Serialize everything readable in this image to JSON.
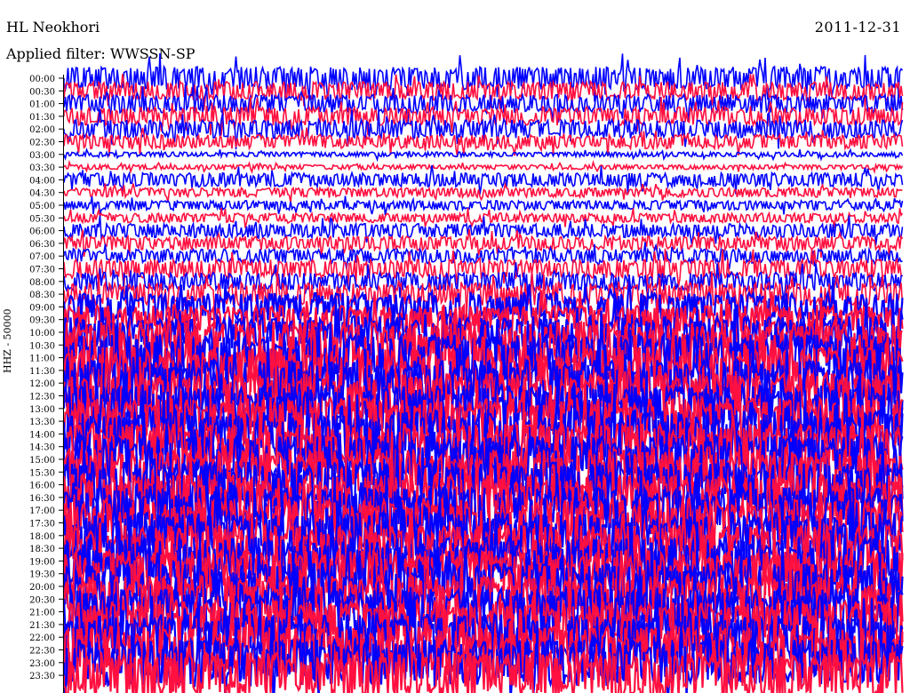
{
  "header": {
    "station": "HL Neokhori",
    "date": "2011-12-31",
    "filter_label": "Applied filter: WWSSN-SP"
  },
  "chart_data": {
    "type": "line",
    "title": "HL Neokhori",
    "subtitle": "Applied filter: WWSSN-SP",
    "ylabel": "HHZ - 50000",
    "row_labels": [
      "00:00",
      "00:30",
      "01:00",
      "01:30",
      "02:00",
      "02:30",
      "03:00",
      "03:30",
      "04:00",
      "04:30",
      "05:00",
      "05:30",
      "06:00",
      "06:30",
      "07:00",
      "07:30",
      "08:00",
      "08:30",
      "09:00",
      "09:30",
      "10:00",
      "10:30",
      "11:00",
      "11:30",
      "12:00",
      "12:30",
      "13:00",
      "13:30",
      "14:00",
      "14:30",
      "15:00",
      "15:30",
      "16:00",
      "16:30",
      "17:00",
      "17:30",
      "18:00",
      "18:30",
      "19:00",
      "19:30",
      "20:00",
      "20:30",
      "21:00",
      "21:30",
      "22:00",
      "22:30",
      "23:00",
      "23:30"
    ],
    "series_colors": [
      "#0000ff",
      "#ff1040"
    ],
    "relative_amplitude": [
      5,
      4,
      4,
      4,
      4,
      3,
      1,
      1,
      3,
      2,
      2,
      2,
      3,
      3,
      3,
      4,
      4,
      5,
      6,
      6,
      7,
      10,
      10,
      10,
      10,
      10,
      10,
      10,
      10,
      10,
      10,
      10,
      10,
      10,
      10,
      10,
      10,
      10,
      10,
      10,
      10,
      10,
      10,
      10,
      10,
      10,
      10,
      10
    ]
  }
}
